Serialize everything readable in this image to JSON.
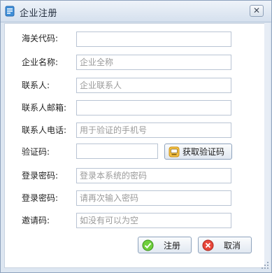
{
  "window": {
    "title": "企业注册",
    "close_glyph": "✕"
  },
  "form": {
    "fields": [
      {
        "label": "海关代码:",
        "placeholder": ""
      },
      {
        "label": "企业名称:",
        "placeholder": "企业全称"
      },
      {
        "label": "联系人:",
        "placeholder": "企业联系人"
      },
      {
        "label": "联系人邮箱:",
        "placeholder": ""
      },
      {
        "label": "联系人电话:",
        "placeholder": "用于验证的手机号"
      },
      {
        "label": "验证码:",
        "placeholder": ""
      },
      {
        "label": "登录密码:",
        "placeholder": "登录本系统的密码"
      },
      {
        "label": "登录密码:",
        "placeholder": "请再次输入密码"
      },
      {
        "label": "邀请码:",
        "placeholder": "如没有可以为空"
      }
    ],
    "get_code_button": {
      "label": "获取验证码",
      "icon": "sms-code-icon"
    }
  },
  "actions": {
    "register": {
      "label": "注册",
      "icon": "check-icon",
      "color": "#4caf2a"
    },
    "cancel": {
      "label": "取消",
      "icon": "cancel-icon",
      "color": "#d9362b"
    }
  },
  "colors": {
    "accent": "#4a90d9",
    "window_frame": "#dde6f1"
  }
}
